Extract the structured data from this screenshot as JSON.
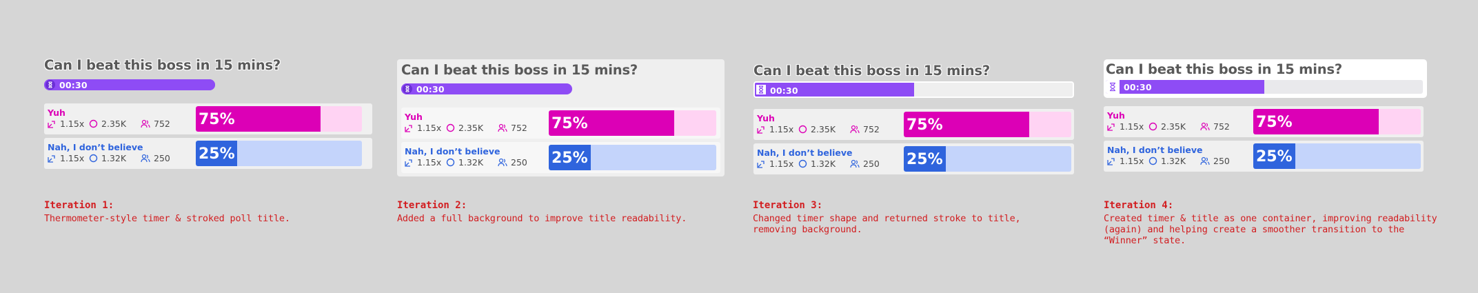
{
  "colors": {
    "background": "#d6d6d6",
    "timer": "#8e4cf5",
    "yes": "#dc00b6",
    "yes_track": "#ffd3f3",
    "no": "#2f64dd",
    "no_track": "#c4d4fb",
    "caption": "#d21d20"
  },
  "iterations": [
    {
      "title": "Can I beat this boss in 15 mins?",
      "timer": {
        "time": "00:30",
        "progress": 1.0,
        "icon": "hourglass-icon"
      },
      "options": [
        {
          "label": "Yuh",
          "multiplier": "1.15x",
          "points": "2.35K",
          "users": "752",
          "percent_label": "75%",
          "percent": 75
        },
        {
          "label": "Nah, I don’t believe",
          "multiplier": "1.15x",
          "points": "1.32K",
          "users": "250",
          "percent_label": "25%",
          "percent": 25
        }
      ],
      "caption_head": "Iteration 1:",
      "caption_body": "Thermometer-style timer & stroked poll title."
    },
    {
      "title": "Can I beat this boss in 15 mins?",
      "timer": {
        "time": "00:30",
        "progress": 1.0,
        "icon": "hourglass-icon"
      },
      "options": [
        {
          "label": "Yuh",
          "multiplier": "1.15x",
          "points": "2.35K",
          "users": "752",
          "percent_label": "75%",
          "percent": 75
        },
        {
          "label": "Nah, I don’t believe",
          "multiplier": "1.15x",
          "points": "1.32K",
          "users": "250",
          "percent_label": "25%",
          "percent": 25
        }
      ],
      "caption_head": "Iteration 2:",
      "caption_body": "Added a full background to improve title readability."
    },
    {
      "title": "Can I beat this boss in 15 mins?",
      "timer": {
        "time": "00:30",
        "progress": 0.5,
        "icon": "hourglass-icon"
      },
      "options": [
        {
          "label": "Yuh",
          "multiplier": "1.15x",
          "points": "2.35K",
          "users": "752",
          "percent_label": "75%",
          "percent": 75
        },
        {
          "label": "Nah, I don’t believe",
          "multiplier": "1.15x",
          "points": "1.32K",
          "users": "250",
          "percent_label": "25%",
          "percent": 25
        }
      ],
      "caption_head": "Iteration 3:",
      "caption_body": "Changed timer shape and returned stroke to title, removing background."
    },
    {
      "title": "Can I beat this boss in 15 mins?",
      "timer": {
        "time": "00:30",
        "progress": 0.5,
        "icon": "hourglass-icon"
      },
      "options": [
        {
          "label": "Yuh",
          "multiplier": "1.15x",
          "points": "2.35K",
          "users": "752",
          "percent_label": "75%",
          "percent": 75
        },
        {
          "label": "Nah, I don’t believe",
          "multiplier": "1.15x",
          "points": "1.32K",
          "users": "250",
          "percent_label": "25%",
          "percent": 25
        }
      ],
      "caption_head": "Iteration 4:",
      "caption_body": "Created timer & title as one container, improving readability (again) and helping create a smoother transition to the “Winner” state."
    }
  ]
}
